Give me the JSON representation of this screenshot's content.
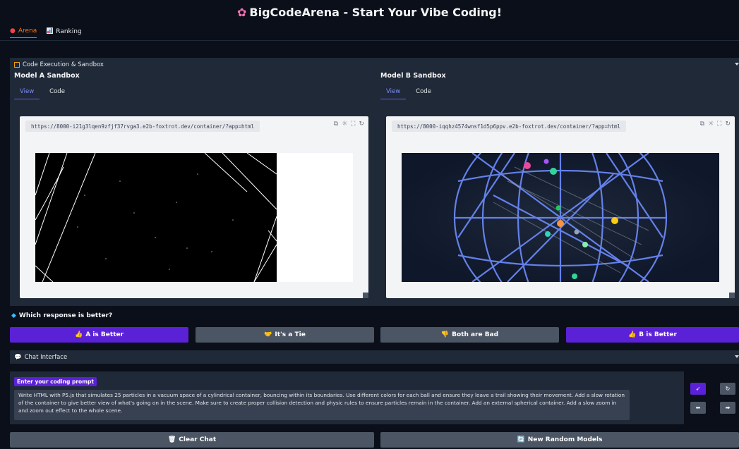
{
  "header": {
    "title": "BigCodeArena - Start Your Vibe Coding!",
    "title_icon": "flower-icon"
  },
  "top_tabs": [
    {
      "label": "Arena",
      "icon": "arena-icon",
      "active": true
    },
    {
      "label": "Ranking",
      "icon": "bar-chart-icon",
      "active": false
    }
  ],
  "sandbox_panel": {
    "title": "Code Execution & Sandbox",
    "model_a": {
      "title": "Model A Sandbox",
      "tabs": [
        "View",
        "Code"
      ],
      "url": "https://8000-i21g3lqen9zfjf37rvga3.e2b-foxtrot.dev/container/?app=html"
    },
    "model_b": {
      "title": "Model B Sandbox",
      "tabs": [
        "View",
        "Code"
      ],
      "url": "https://8000-iqqhz4574wnsf1d5p6ppv.e2b-foxtrot.dev/container/?app=html"
    }
  },
  "vote": {
    "question": "Which response is better?",
    "buttons": [
      {
        "label": "A is Better",
        "icon": "👍"
      },
      {
        "label": "It's a Tie",
        "icon": "🤝"
      },
      {
        "label": "Both are Bad",
        "icon": "👎"
      },
      {
        "label": "B is Better",
        "icon": "👍"
      }
    ]
  },
  "chat": {
    "title": "Chat Interface",
    "prompt_label": "Enter your coding prompt",
    "prompt_text": "Write HTML with P5.js that simulates 25 particles in a vacuum space of a cylindrical container, bouncing within its boundaries. Use different colors for each ball and ensure they leave a trail showing their movement. Add a slow rotation of the container to give better view of what's going on in the scene. Make sure to create proper collision detection and physic rules to ensure particles remain in the container. Add an external spherical container. Add a slow zoom in and zoom out effect to the whole scene.",
    "clear_label": "Clear Chat",
    "new_models_label": "New Random Models"
  },
  "colors": {
    "accent": "#5b21d6",
    "tab_active": "#f97316",
    "bg": "#0b0f19",
    "panel": "#1f2937"
  }
}
